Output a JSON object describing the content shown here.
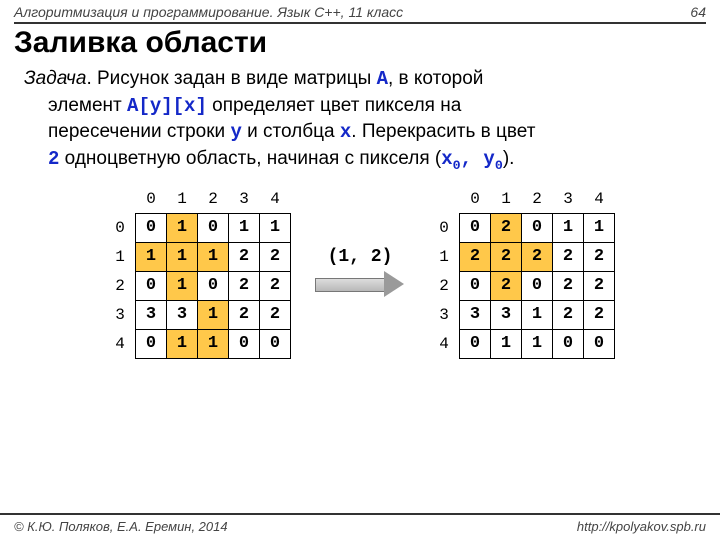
{
  "header": {
    "course": "Алгоритмизация и программирование. Язык C++, 11 класс",
    "page": "64"
  },
  "title": "Заливка области",
  "task": {
    "lead": "Задача",
    "t1": ". Рисунок задан в виде матрицы ",
    "A": "A",
    "t2": ", в которой",
    "t3": "элемент ",
    "Ayx": "A[y][x]",
    "t4": " определяет цвет пикселя на",
    "t5": "пересечении строки ",
    "y": "y",
    "t6": " и столбца ",
    "x": "x",
    "t7": ". Перекрасить в цвет",
    "two": "2",
    "t8": " одноцветную область, начиная с пикселя (",
    "x0": "x",
    "x0s": "0",
    "comma": ", ",
    "y0": "y",
    "y0s": "0",
    "t9": ")."
  },
  "mid_label": "(1, 2)",
  "cols": [
    "0",
    "1",
    "2",
    "3",
    "4"
  ],
  "rows": [
    "0",
    "1",
    "2",
    "3",
    "4"
  ],
  "matL": [
    [
      "0",
      "1",
      "0",
      "1",
      "1"
    ],
    [
      "1",
      "1",
      "1",
      "2",
      "2"
    ],
    [
      "0",
      "1",
      "0",
      "2",
      "2"
    ],
    [
      "3",
      "3",
      "1",
      "2",
      "2"
    ],
    [
      "0",
      "1",
      "1",
      "0",
      "0"
    ]
  ],
  "hlL": [
    [
      0,
      1,
      0,
      0,
      0
    ],
    [
      1,
      1,
      1,
      0,
      0
    ],
    [
      0,
      1,
      0,
      0,
      0
    ],
    [
      0,
      0,
      1,
      0,
      0
    ],
    [
      0,
      1,
      1,
      0,
      0
    ]
  ],
  "matR": [
    [
      "0",
      "2",
      "0",
      "1",
      "1"
    ],
    [
      "2",
      "2",
      "2",
      "2",
      "2"
    ],
    [
      "0",
      "2",
      "0",
      "2",
      "2"
    ],
    [
      "3",
      "3",
      "1",
      "2",
      "2"
    ],
    [
      "0",
      "1",
      "1",
      "0",
      "0"
    ]
  ],
  "hlR": [
    [
      0,
      1,
      0,
      0,
      0
    ],
    [
      1,
      1,
      1,
      0,
      0
    ],
    [
      0,
      1,
      0,
      0,
      0
    ],
    [
      0,
      0,
      0,
      0,
      0
    ],
    [
      0,
      0,
      0,
      0,
      0
    ]
  ],
  "footer": {
    "left": "© К.Ю. Поляков, Е.А. Еремин, 2014",
    "right": "http://kpolyakov.spb.ru"
  }
}
